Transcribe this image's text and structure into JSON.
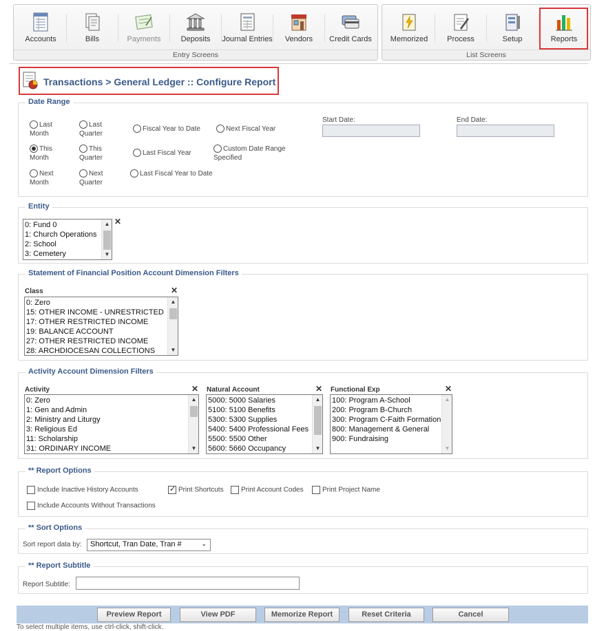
{
  "toolbar": {
    "entry_caption": "Entry Screens",
    "list_caption": "List Screens",
    "entry": [
      {
        "label": "Accounts",
        "icon": "accounts-icon"
      },
      {
        "label": "Bills",
        "icon": "bills-icon"
      },
      {
        "label": "Payments",
        "icon": "payments-icon"
      },
      {
        "label": "Deposits",
        "icon": "deposits-icon"
      },
      {
        "label": "Journal Entries",
        "icon": "journal-entries-icon"
      },
      {
        "label": "Vendors",
        "icon": "vendors-icon"
      },
      {
        "label": "Credit Cards",
        "icon": "credit-cards-icon"
      }
    ],
    "list": [
      {
        "label": "Memorized",
        "icon": "memorized-icon"
      },
      {
        "label": "Process",
        "icon": "process-icon"
      },
      {
        "label": "Setup",
        "icon": "setup-icon"
      },
      {
        "label": "Reports",
        "icon": "reports-icon"
      }
    ]
  },
  "page_title": "Transactions > General Ledger :: Configure Report",
  "date_range": {
    "legend": "Date Range",
    "options": {
      "last_month": "Last Month",
      "last_quarter": "Last Quarter",
      "fiscal_ytd": "Fiscal Year to Date",
      "next_fiscal": "Next Fiscal Year",
      "this_month": "This Month",
      "this_quarter": "This Quarter",
      "last_fiscal": "Last Fiscal Year",
      "custom": "Custom Date Range Specified",
      "next_month": "Next Month",
      "next_quarter": "Next Quarter",
      "last_fiscal_ytd": "Last Fiscal Year to Date"
    },
    "selected": "This Month",
    "start_label": "Start Date:",
    "end_label": "End Date:",
    "start_value": "",
    "end_value": ""
  },
  "entity": {
    "legend": "Entity",
    "items": [
      "0: Fund 0",
      "1: Church Operations",
      "2: School",
      "3: Cemetery"
    ]
  },
  "sofp": {
    "legend": "Statement of Financial Position Account Dimension Filters",
    "class_label": "Class",
    "class_items": [
      "0: Zero",
      "15: OTHER INCOME - UNRESTRICTED",
      "17: OTHER RESTRICTED INCOME",
      "19: BALANCE ACCOUNT",
      "27: OTHER RESTRICTED INCOME",
      "28: ARCHDIOCESAN COLLECTIONS"
    ]
  },
  "activity": {
    "legend": "Activity Account Dimension Filters",
    "activity_label": "Activity",
    "activity_items": [
      "0: Zero",
      "1: Gen and Admin",
      "2: Ministry and Liturgy",
      "3: Religious Ed",
      "11: Scholarship",
      "31: ORDINARY INCOME"
    ],
    "natural_label": "Natural Account",
    "natural_items": [
      "5000: 5000 Salaries",
      "5100: 5100 Benefits",
      "5300: 5300 Supplies",
      "5400: 5400 Professional Fees",
      "5500: 5500 Other",
      "5600: 5660 Occupancy"
    ],
    "functional_label": "Functional Exp",
    "functional_items": [
      "100: Program A-School",
      "200: Program B-Church",
      "300: Program C-Faith Formation",
      "800: Management & General",
      "900: Fundraising"
    ]
  },
  "report_options": {
    "legend": "** Report Options",
    "inactive": "Include Inactive History Accounts",
    "print_shortcuts": "Print Shortcuts",
    "print_account_codes": "Print Account Codes",
    "print_project_name": "Print Project Name",
    "without_transactions": "Include Accounts Without Transactions",
    "print_shortcuts_checked": true
  },
  "sort_options": {
    "legend": "** Sort Options",
    "label": "Sort report data by:",
    "value": "Shortcut, Tran Date, Tran #"
  },
  "subtitle": {
    "legend": "** Report Subtitle",
    "label": "Report Subtitle:",
    "value": ""
  },
  "buttons": {
    "preview": "Preview Report",
    "pdf": "View PDF",
    "memorize": "Memorize Report",
    "reset": "Reset Criteria",
    "cancel": "Cancel"
  },
  "footnote": "To select multiple items, use ctrl-click, shift-click."
}
